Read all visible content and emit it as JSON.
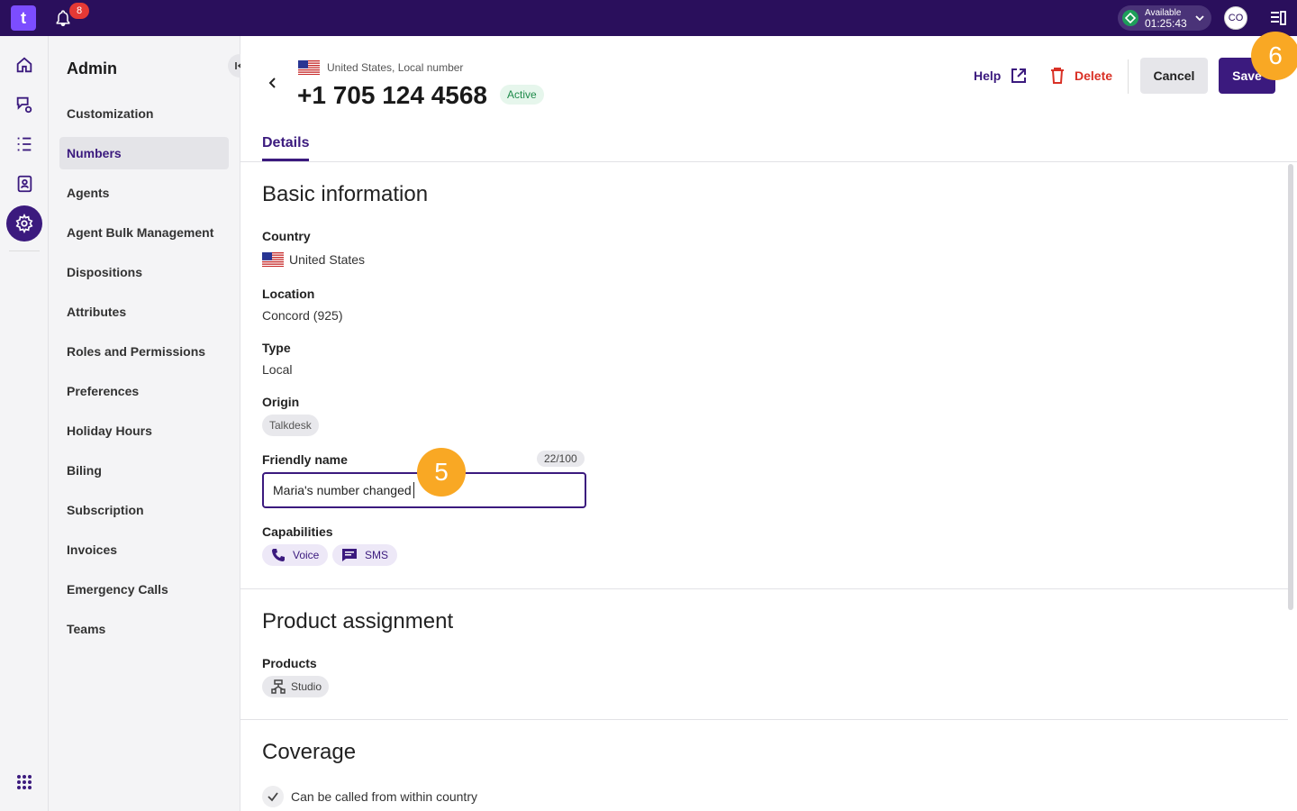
{
  "topbar": {
    "logo": "t",
    "notifications_count": "8",
    "status_label": "Available",
    "status_time": "01:25:43",
    "avatar_initials": "CO",
    "status_color": "#1e9e5a",
    "bar_color": "#2a0f5c"
  },
  "rail": {
    "items": [
      "home-icon",
      "conversations-icon",
      "list-icon",
      "contacts-icon",
      "admin-gear-icon",
      "apps-grid-icon"
    ]
  },
  "sidebar": {
    "title": "Admin",
    "items": [
      {
        "label": "Customization"
      },
      {
        "label": "Numbers"
      },
      {
        "label": "Agents"
      },
      {
        "label": "Agent Bulk Management"
      },
      {
        "label": "Dispositions"
      },
      {
        "label": "Attributes"
      },
      {
        "label": "Roles and Permissions"
      },
      {
        "label": "Preferences"
      },
      {
        "label": "Holiday Hours"
      },
      {
        "label": "Biling"
      },
      {
        "label": "Subscription"
      },
      {
        "label": "Invoices"
      },
      {
        "label": "Emergency Calls"
      },
      {
        "label": "Teams"
      }
    ],
    "active_index": 1
  },
  "header": {
    "subtitle": "United States, Local number",
    "phone": "+1 705 124 4568",
    "status_badge": "Active",
    "help_label": "Help",
    "delete_label": "Delete",
    "cancel_label": "Cancel",
    "save_label": "Save"
  },
  "tabs": [
    {
      "label": "Details"
    }
  ],
  "basic": {
    "title": "Basic information",
    "country_label": "Country",
    "country_value": "United States",
    "location_label": "Location",
    "location_value": "Concord (925)",
    "type_label": "Type",
    "type_value": "Local",
    "origin_label": "Origin",
    "origin_value": "Talkdesk",
    "friendly_label": "Friendly name",
    "friendly_counter": "22/100",
    "friendly_value": "Maria's number changed",
    "capabilities_label": "Capabilities",
    "capabilities": [
      "Voice",
      "SMS"
    ]
  },
  "product": {
    "title": "Product assignment",
    "products_label": "Products",
    "products": [
      "Studio"
    ]
  },
  "coverage": {
    "title": "Coverage",
    "items": [
      "Can be called from within country"
    ]
  },
  "steps": [
    "5",
    "6"
  ],
  "colors": {
    "accent": "#3b1a7e",
    "danger": "#d93025",
    "step": "#f9a824",
    "active_badge": "#1e8a4a"
  }
}
